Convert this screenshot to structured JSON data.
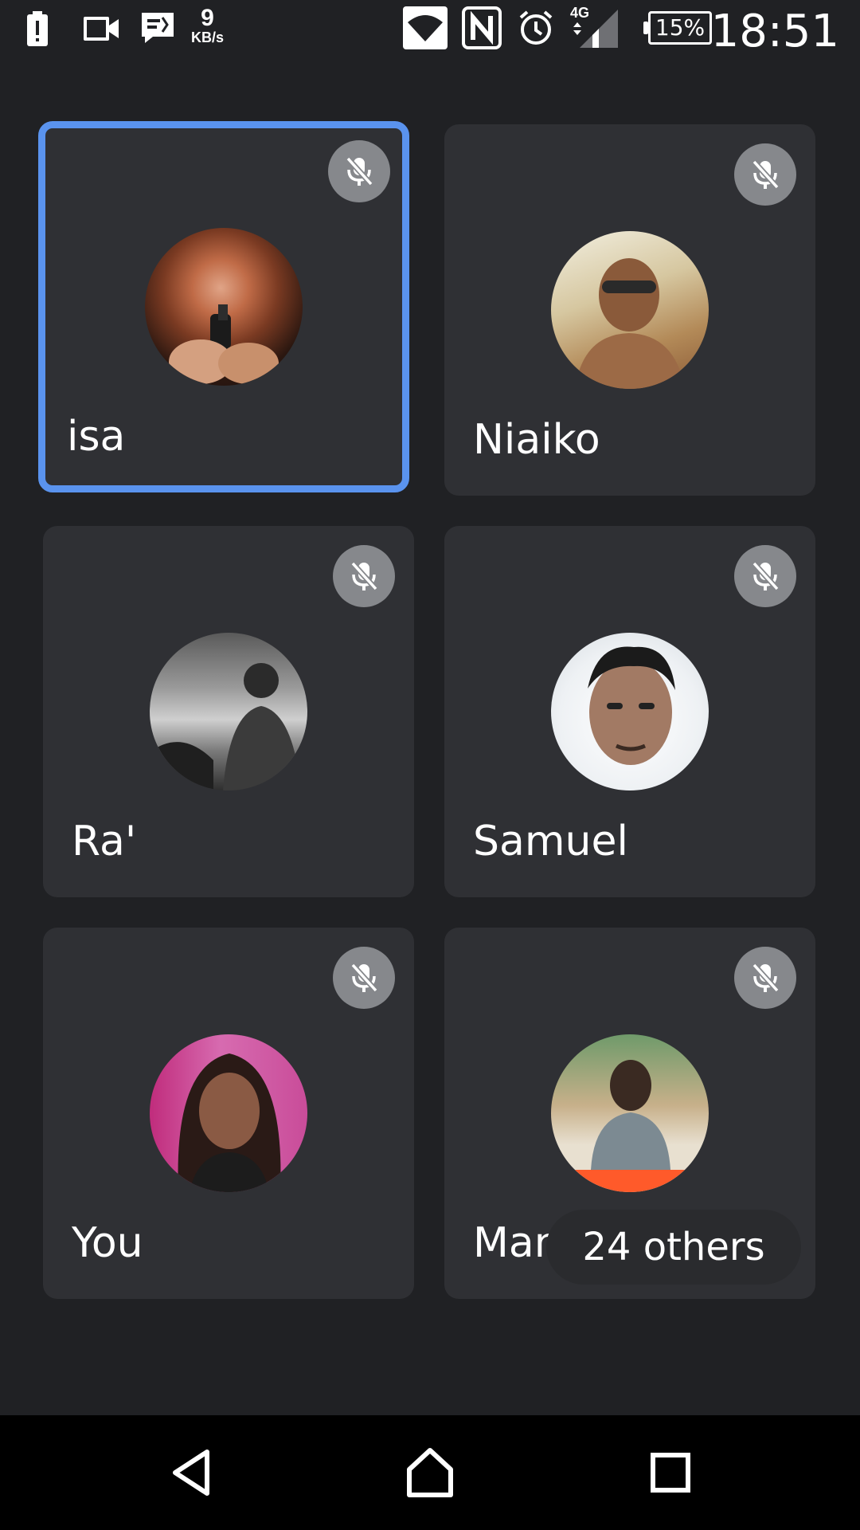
{
  "status_bar": {
    "network_speed_value": "9",
    "network_speed_unit": "KB/s",
    "network_type": "4G",
    "battery": "15%",
    "time": "18:51",
    "icons": [
      "alert-icon",
      "video-camera-icon",
      "message-icon",
      "wifi-icon",
      "nfc-icon",
      "alarm-icon",
      "signal-icon",
      "battery-icon"
    ]
  },
  "participants": [
    {
      "name": "isa",
      "muted": true,
      "active": true,
      "avatar_icon": "avatar-photo"
    },
    {
      "name": "Niaiko",
      "muted": true,
      "active": false,
      "avatar_icon": "avatar-photo"
    },
    {
      "name": "Ra'",
      "muted": true,
      "active": false,
      "avatar_icon": "avatar-photo"
    },
    {
      "name": "Samuel",
      "muted": true,
      "active": false,
      "avatar_icon": "avatar-photo"
    },
    {
      "name": "You",
      "muted": true,
      "active": false,
      "avatar_icon": "avatar-photo"
    },
    {
      "name": "Manambintsoa",
      "muted": true,
      "active": false,
      "avatar_icon": "avatar-photo"
    }
  ],
  "others_chip": "24 others",
  "colors": {
    "background": "#202124",
    "tile": "#2f3034",
    "active_border": "#5a93ee",
    "mic_badge": "#86888c"
  },
  "nav_bar": {
    "icons": [
      "back-icon",
      "home-icon",
      "recents-icon"
    ]
  }
}
